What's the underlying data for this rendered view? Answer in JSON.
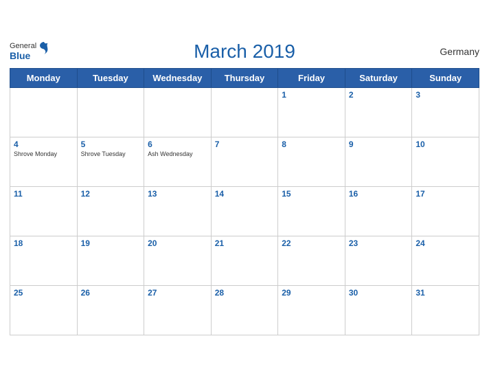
{
  "header": {
    "title": "March 2019",
    "country": "Germany",
    "logo_general": "General",
    "logo_blue": "Blue"
  },
  "weekdays": [
    "Monday",
    "Tuesday",
    "Wednesday",
    "Thursday",
    "Friday",
    "Saturday",
    "Sunday"
  ],
  "weeks": [
    [
      {
        "day": "",
        "holiday": ""
      },
      {
        "day": "",
        "holiday": ""
      },
      {
        "day": "",
        "holiday": ""
      },
      {
        "day": "",
        "holiday": ""
      },
      {
        "day": "1",
        "holiday": ""
      },
      {
        "day": "2",
        "holiday": ""
      },
      {
        "day": "3",
        "holiday": ""
      }
    ],
    [
      {
        "day": "4",
        "holiday": "Shrove Monday"
      },
      {
        "day": "5",
        "holiday": "Shrove Tuesday"
      },
      {
        "day": "6",
        "holiday": "Ash Wednesday"
      },
      {
        "day": "7",
        "holiday": ""
      },
      {
        "day": "8",
        "holiday": ""
      },
      {
        "day": "9",
        "holiday": ""
      },
      {
        "day": "10",
        "holiday": ""
      }
    ],
    [
      {
        "day": "11",
        "holiday": ""
      },
      {
        "day": "12",
        "holiday": ""
      },
      {
        "day": "13",
        "holiday": ""
      },
      {
        "day": "14",
        "holiday": ""
      },
      {
        "day": "15",
        "holiday": ""
      },
      {
        "day": "16",
        "holiday": ""
      },
      {
        "day": "17",
        "holiday": ""
      }
    ],
    [
      {
        "day": "18",
        "holiday": ""
      },
      {
        "day": "19",
        "holiday": ""
      },
      {
        "day": "20",
        "holiday": ""
      },
      {
        "day": "21",
        "holiday": ""
      },
      {
        "day": "22",
        "holiday": ""
      },
      {
        "day": "23",
        "holiday": ""
      },
      {
        "day": "24",
        "holiday": ""
      }
    ],
    [
      {
        "day": "25",
        "holiday": ""
      },
      {
        "day": "26",
        "holiday": ""
      },
      {
        "day": "27",
        "holiday": ""
      },
      {
        "day": "28",
        "holiday": ""
      },
      {
        "day": "29",
        "holiday": ""
      },
      {
        "day": "30",
        "holiday": ""
      },
      {
        "day": "31",
        "holiday": ""
      }
    ]
  ]
}
